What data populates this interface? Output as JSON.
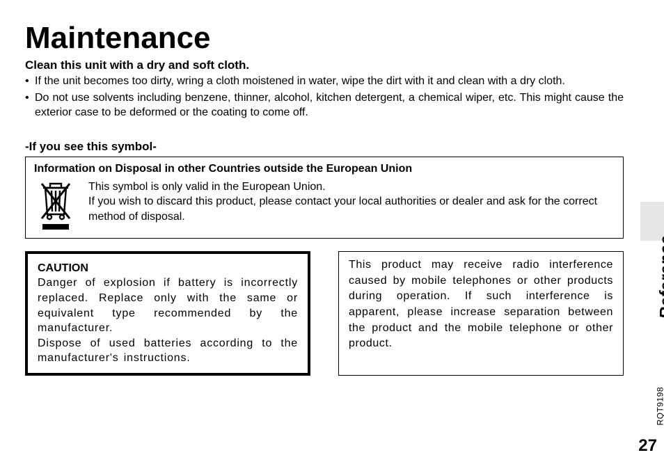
{
  "title": "Maintenance",
  "clean": {
    "heading": "Clean this unit with a dry and soft cloth.",
    "bullets": [
      "If the unit becomes too dirty, wring a cloth moistened in water, wipe the dirt with it and clean with a dry cloth.",
      "Do not use solvents including benzene, thinner, alcohol, kitchen detergent, a chemical wiper, etc. This might cause the exterior case to be deformed or the coating to come off."
    ]
  },
  "symbol": {
    "heading": "-If you see this symbol-",
    "box_title": "Information on Disposal in other Countries outside the European Union",
    "line1": "This symbol is only valid in the European Union.",
    "line2": "If you wish to discard this product, please contact your local authorities or dealer and ask for the correct method of disposal."
  },
  "caution": {
    "title": "CAUTION",
    "p1": "Danger of explosion if battery is incorrectly replaced. Replace only with the same or equivalent type recommended by the manufacturer.",
    "p2": "Dispose of used batteries according to the manufacturer's instructions."
  },
  "interference": "This product may receive radio interference caused by mobile telephones or other products during operation. If such interference is apparent, please increase separation between the product and the mobile telephone or other product.",
  "side": {
    "reference": "Reference",
    "code": "RQT9198",
    "page": "27"
  }
}
